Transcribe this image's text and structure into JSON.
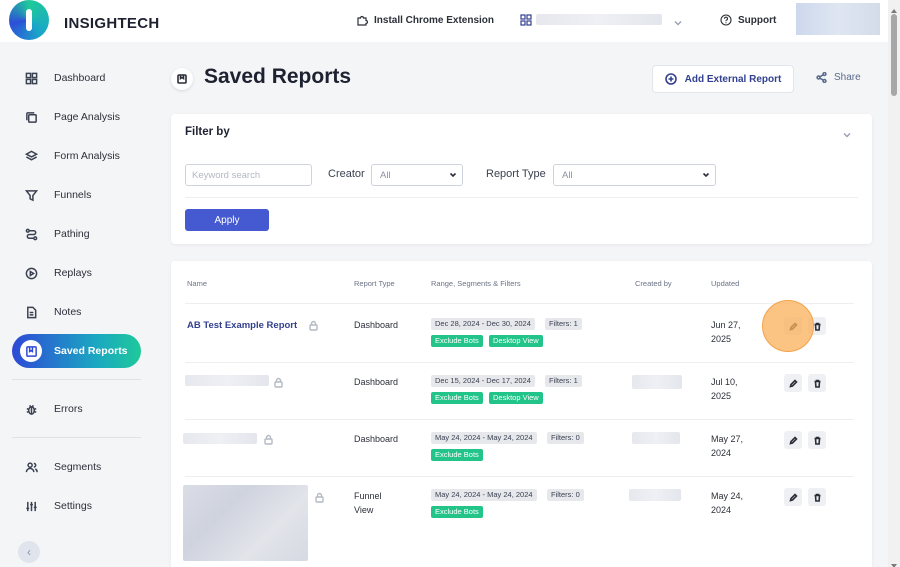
{
  "app": {
    "brand": "INSIGHTECH"
  },
  "topbar": {
    "install_extension": "Install Chrome Extension",
    "support": "Support"
  },
  "sidebar": {
    "items": [
      {
        "label": "Dashboard",
        "icon": "grid-icon"
      },
      {
        "label": "Page Analysis",
        "icon": "pages-icon"
      },
      {
        "label": "Form Analysis",
        "icon": "layers-icon"
      },
      {
        "label": "Funnels",
        "icon": "funnel-icon"
      },
      {
        "label": "Pathing",
        "icon": "path-icon"
      },
      {
        "label": "Replays",
        "icon": "replay-icon"
      },
      {
        "label": "Notes",
        "icon": "note-icon"
      },
      {
        "label": "Saved Reports",
        "icon": "bookmark-icon",
        "active": true
      },
      {
        "label": "Errors",
        "icon": "bug-icon"
      },
      {
        "label": "Segments",
        "icon": "users-icon"
      },
      {
        "label": "Settings",
        "icon": "sliders-icon"
      }
    ]
  },
  "page": {
    "title": "Saved Reports",
    "add_external": "Add External Report",
    "share": "Share"
  },
  "filter": {
    "title": "Filter by",
    "keyword_placeholder": "Keyword search",
    "creator_label": "Creator",
    "creator_value": "All",
    "report_type_label": "Report Type",
    "report_type_value": "All",
    "apply": "Apply"
  },
  "table": {
    "headers": {
      "name": "Name",
      "report_type": "Report Type",
      "range": "Range, Segments & Filters",
      "created_by": "Created by",
      "updated": "Updated"
    },
    "rows": [
      {
        "name": "AB Test Example Report",
        "type": "Dashboard",
        "range": "Dec 28, 2024 - Dec 30, 2024",
        "filters": "Filters: 1",
        "tags": [
          "Exclude Bots",
          "Desktop View"
        ],
        "updated_line1": "Jun 27,",
        "updated_line2": "2025"
      },
      {
        "name": "",
        "type": "Dashboard",
        "range": "Dec 15, 2024 - Dec 17, 2024",
        "filters": "Filters: 1",
        "tags": [
          "Exclude Bots",
          "Desktop View"
        ],
        "updated_line1": "Jul 10,",
        "updated_line2": "2025"
      },
      {
        "name": "",
        "type": "Dashboard",
        "range": "May 24, 2024 - May 24, 2024",
        "filters": "Filters: 0",
        "tags": [
          "Exclude Bots"
        ],
        "updated_line1": "May 27,",
        "updated_line2": "2024"
      },
      {
        "name": "",
        "type_line1": "Funnel",
        "type_line2": "View",
        "range": "May 24, 2024 - May 24, 2024",
        "filters": "Filters: 0",
        "tags": [
          "Exclude Bots"
        ],
        "updated_line1": "May 24,",
        "updated_line2": "2024"
      }
    ]
  },
  "colors": {
    "accent": "#33408f",
    "apply": "#4559d0",
    "tag_green": "#22c48a",
    "active_gradient_start": "#2e49d6",
    "active_gradient_end": "#1fc99a",
    "highlight": "#fab05a"
  }
}
